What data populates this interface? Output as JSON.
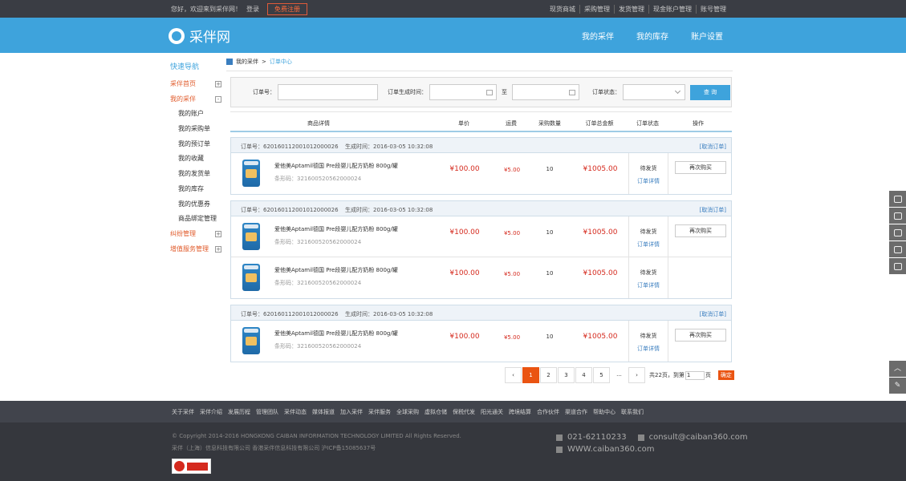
{
  "topbar": {
    "greeting": "您好，欢迎来到采伴网！",
    "login": "登录",
    "register": "免费注册",
    "links": [
      "现货商城",
      "采购管理",
      "发货管理",
      "现金账户管理",
      "账号管理"
    ]
  },
  "header": {
    "logo": "采伴网",
    "nav": [
      "我的采伴",
      "我的库存",
      "账户设置"
    ]
  },
  "sidebar": {
    "title": "快速导航",
    "items": [
      {
        "label": "采伴首页",
        "type": "red",
        "toggle": "+"
      },
      {
        "label": "我的采伴",
        "type": "red",
        "toggle": "-"
      },
      {
        "label": "我的账户",
        "type": "sub"
      },
      {
        "label": "我的采购单",
        "type": "sub"
      },
      {
        "label": "我的预订单",
        "type": "sub"
      },
      {
        "label": "我的收藏",
        "type": "sub"
      },
      {
        "label": "我的发货单",
        "type": "sub"
      },
      {
        "label": "我的库存",
        "type": "sub"
      },
      {
        "label": "我的优惠券",
        "type": "sub"
      },
      {
        "label": "商品绑定管理",
        "type": "sub"
      },
      {
        "label": "纠纷管理",
        "type": "red",
        "toggle": "+"
      },
      {
        "label": "增值服务管理",
        "type": "red",
        "toggle": "+"
      }
    ]
  },
  "breadcrumb": {
    "root": "我的采伴",
    "sep": ">",
    "current": "订单中心"
  },
  "filter": {
    "order_no_label": "订单号：",
    "time_label": "订单生成时间：",
    "to_label": "至",
    "status_label": "订单状态：",
    "search_button": "查 询"
  },
  "table_headers": [
    "商品详情",
    "单价",
    "运费",
    "采购数量",
    "订单总金额",
    "订单状态",
    "操作"
  ],
  "orders": [
    {
      "order_no": "订单号：62016011200101200002​6",
      "time": "生成时间：2016-03-05 10:32:08",
      "cancel": "[取消订单]",
      "products": [
        {
          "name": "爱他美Aptamil德国 Pre段婴儿配方奶粉 800g/罐",
          "code": "条形码：3216005205620000​24",
          "price": "¥100.00",
          "shipping": "¥5.00",
          "qty": "10",
          "total": "¥1005.00",
          "status": "待发货",
          "detail": "订单详情"
        }
      ],
      "action": "再次购买"
    },
    {
      "order_no": "订单号：62016011200101200002​6",
      "time": "生成时间：2016-03-05 10:32:08",
      "cancel": "[取消订单]",
      "products": [
        {
          "name": "爱他美Aptamil德国 Pre段婴儿配方奶粉 800g/罐",
          "code": "条形码：3216005205620000​24",
          "price": "¥100.00",
          "shipping": "¥5.00",
          "qty": "10",
          "total": "¥1005.00",
          "status": "待发货",
          "detail": "订单详情"
        },
        {
          "name": "爱他美Aptamil德国 Pre段婴儿配方奶粉 800g/罐",
          "code": "条形码：3216005205620000​24",
          "price": "¥100.00",
          "shipping": "¥5.00",
          "qty": "10",
          "total": "¥1005.00",
          "status": "待发货",
          "detail": "订单详情"
        }
      ],
      "action": "再次购买"
    },
    {
      "order_no": "订单号：62016011200101200002​6",
      "time": "生成时间：2016-03-05 10:32:08",
      "cancel": "[取消订单]",
      "products": [
        {
          "name": "爱他美Aptamil德国 Pre段婴儿配方奶粉 800g/罐",
          "code": "条形码：3216005205620000​24",
          "price": "¥100.00",
          "shipping": "¥5.00",
          "qty": "10",
          "total": "¥1005.00",
          "status": "待发货",
          "detail": "订单详情"
        }
      ],
      "action": "再次购买"
    }
  ],
  "pagination": {
    "prev": "‹",
    "pages": [
      "1",
      "2",
      "3",
      "4",
      "5"
    ],
    "ellipsis": "...",
    "next": "›",
    "total_text": "共22页，到第",
    "jump_value": "1",
    "page_unit": "页",
    "go": "确定"
  },
  "footer": {
    "links": [
      "关于采伴",
      "采伴介绍",
      "发展历程",
      "管理团队",
      "采伴动态",
      "媒体报道",
      "加入采伴",
      "采伴服务",
      "全球采购",
      "虚拟仓储",
      "保税代发",
      "阳光通关",
      "跨境结算",
      "合作伙伴",
      "渠道合作",
      "帮助中心",
      "联系我们"
    ],
    "copyright": "© Copyright 2014-2016 HONGKONG CAIBAN INFORMATION TECHNOLOGY LIMITED All Rights Reserved.",
    "icp": "采伴（上海）信息科技有限公司 香港采伴信息科技有限公司 沪ICP备15085637号",
    "phone": "021-62110233",
    "email": "consult@caiban360.com",
    "website": "WWW.caiban360.com"
  }
}
